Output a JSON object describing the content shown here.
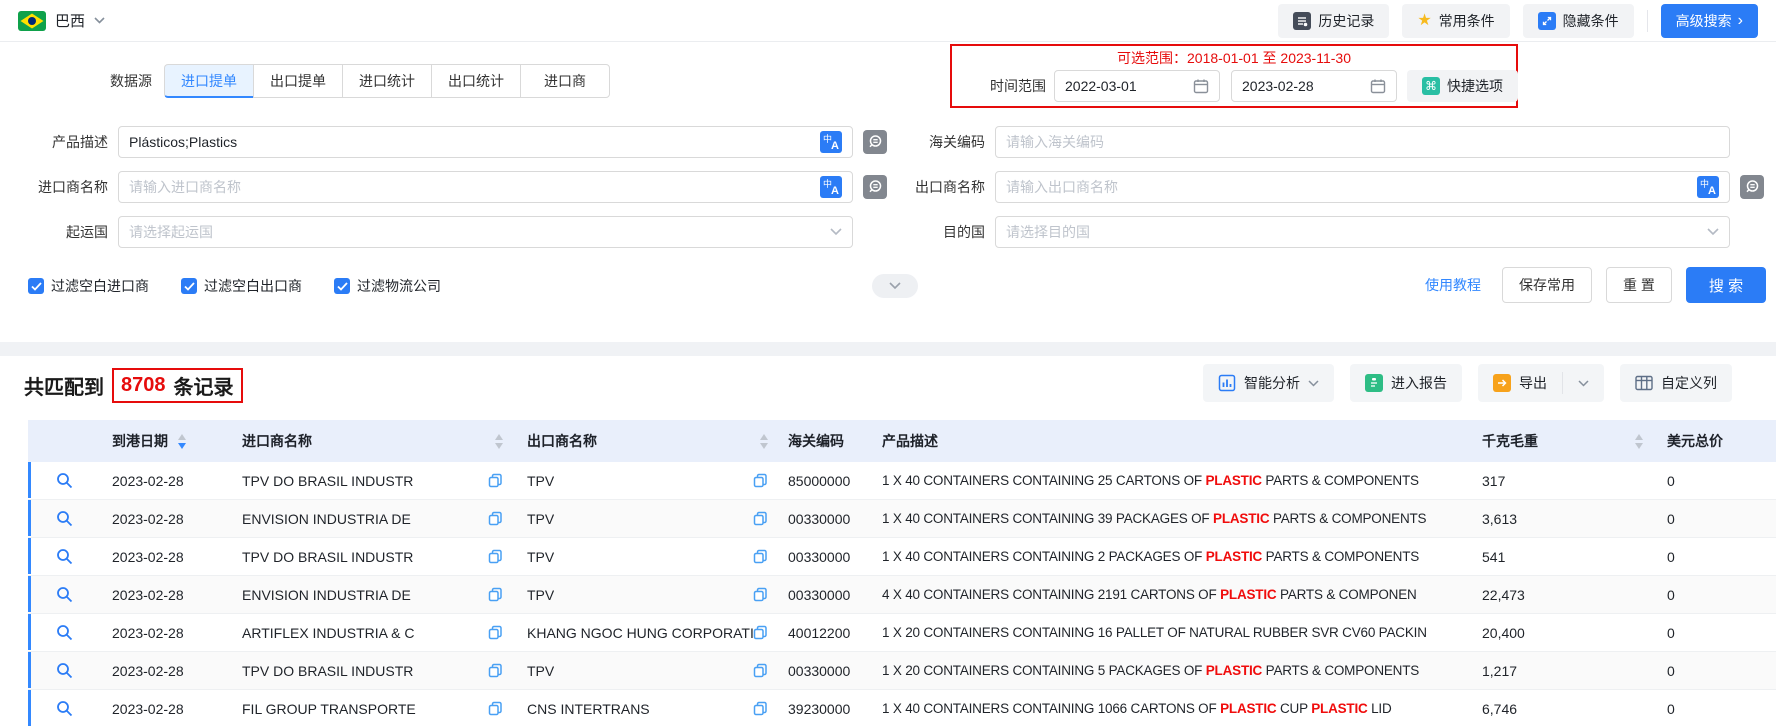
{
  "topbar": {
    "country": "巴西",
    "history_btn": "历史记录",
    "favorites_btn": "常用条件",
    "hide_btn": "隐藏条件",
    "advanced_btn": "高级搜索",
    "advanced_arrow": "›"
  },
  "search_form": {
    "data_source_label": "数据源",
    "tabs": [
      {
        "label": "进口提单",
        "active": true
      },
      {
        "label": "出口提单",
        "active": false
      },
      {
        "label": "进口统计",
        "active": false
      },
      {
        "label": "出口统计",
        "active": false
      },
      {
        "label": "进口商",
        "active": false
      }
    ],
    "date_range": {
      "label": "时间范围",
      "hint": "可选范围：2018-01-01 至 2023-11-30",
      "start": "2022-03-01",
      "end": "2023-02-28",
      "quick_btn": "快捷选项",
      "quick_icon_glyph": "⌘"
    },
    "fields": {
      "product_desc": {
        "label": "产品描述",
        "value": "Plásticos;Plastics"
      },
      "hs_code": {
        "label": "海关编码",
        "placeholder": "请输入海关编码"
      },
      "importer": {
        "label": "进口商名称",
        "placeholder": "请输入进口商名称"
      },
      "exporter": {
        "label": "出口商名称",
        "placeholder": "请输入出口商名称"
      },
      "origin_country": {
        "label": "起运国",
        "placeholder": "请选择起运国"
      },
      "dest_country": {
        "label": "目的国",
        "placeholder": "请选择目的国"
      }
    },
    "checkboxes": [
      {
        "label": "过滤空白进口商",
        "checked": true
      },
      {
        "label": "过滤空白出口商",
        "checked": true
      },
      {
        "label": "过滤物流公司",
        "checked": true
      }
    ],
    "tutorial_link": "使用教程",
    "save_btn": "保存常用",
    "reset_btn": "重 置",
    "search_btn": "搜 索"
  },
  "results": {
    "summary_prefix": "共匹配到",
    "count": "8708",
    "summary_suffix": "条记录",
    "toolbar": {
      "analysis": "智能分析",
      "report": "进入报告",
      "export": "导出",
      "custom_columns": "自定义列"
    },
    "table": {
      "columns": [
        "到港日期",
        "进口商名称",
        "出口商名称",
        "海关编码",
        "产品描述",
        "千克毛重",
        "美元总价"
      ],
      "highlight_term": "PLASTIC",
      "highlight_color": "#f00c0c",
      "rows": [
        {
          "date": "2023-02-28",
          "importer": "TPV DO BRASIL INDUSTR",
          "exporter": "TPV",
          "hs": "85000000",
          "product": "1 X 40 CONTAINERS CONTAINING 25 CARTONS OF PLASTIC PARTS & COMPONENTS",
          "weight": "317",
          "value": "0"
        },
        {
          "date": "2023-02-28",
          "importer": "ENVISION INDUSTRIA DE",
          "exporter": "TPV",
          "hs": "00330000",
          "product": "1 X 40 CONTAINERS CONTAINING 39 PACKAGES OF PLASTIC PARTS & COMPONENTS",
          "weight": "3,613",
          "value": "0"
        },
        {
          "date": "2023-02-28",
          "importer": "TPV DO BRASIL INDUSTR",
          "exporter": "TPV",
          "hs": "00330000",
          "product": "1 X 40 CONTAINERS CONTAINING 2 PACKAGES OF PLASTIC PARTS & COMPONENTS",
          "weight": "541",
          "value": "0"
        },
        {
          "date": "2023-02-28",
          "importer": "ENVISION INDUSTRIA DE",
          "exporter": "TPV",
          "hs": "00330000",
          "product": "4 X 40 CONTAINERS CONTAINING 2191 CARTONS OF PLASTIC PARTS & COMPONEN",
          "weight": "22,473",
          "value": "0"
        },
        {
          "date": "2023-02-28",
          "importer": "ARTIFLEX INDUSTRIA & C",
          "exporter": "KHANG NGOC HUNG CORPORATION",
          "hs": "40012200",
          "product": "1 X 20 CONTAINERS CONTAINING 16 PALLET OF NATURAL RUBBER SVR CV60 PACKIN",
          "weight": "20,400",
          "value": "0"
        },
        {
          "date": "2023-02-28",
          "importer": "TPV DO BRASIL INDUSTR",
          "exporter": "TPV",
          "hs": "00330000",
          "product": "1 X 20 CONTAINERS CONTAINING 5 PACKAGES OF PLASTIC PARTS & COMPONENTS",
          "weight": "1,217",
          "value": "0"
        },
        {
          "date": "2023-02-28",
          "importer": "FIL GROUP TRANSPORTE",
          "exporter": "CNS INTERTRANS",
          "hs": "39230000",
          "product": "1 X 40 CONTAINERS CONTAINING 1066 CARTONS OF PLASTIC CUP PLASTIC LID",
          "weight": "6,746",
          "value": "0"
        }
      ]
    }
  }
}
